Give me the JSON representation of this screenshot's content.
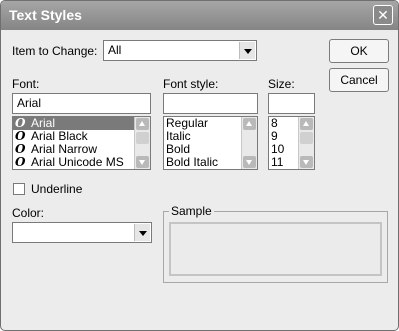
{
  "dialog": {
    "title": "Text Styles",
    "close_glyph": "✕"
  },
  "item_to_change": {
    "label": "Item to Change:",
    "value": "All"
  },
  "buttons": {
    "ok": "OK",
    "cancel": "Cancel"
  },
  "font": {
    "label": "Font:",
    "value": "Arial",
    "icon_glyph": "O",
    "items": [
      "Arial",
      "Arial Black",
      "Arial Narrow",
      "Arial Unicode MS"
    ],
    "selected_index": 0
  },
  "font_style": {
    "label": "Font style:",
    "value": "",
    "items": [
      "Regular",
      "Italic",
      "Bold",
      "Bold Italic"
    ]
  },
  "size": {
    "label": "Size:",
    "value": "",
    "items": [
      "8",
      "9",
      "10",
      "11"
    ]
  },
  "underline": {
    "label": "Underline",
    "checked": false
  },
  "color": {
    "label": "Color:",
    "value": ""
  },
  "sample": {
    "label": "Sample"
  }
}
